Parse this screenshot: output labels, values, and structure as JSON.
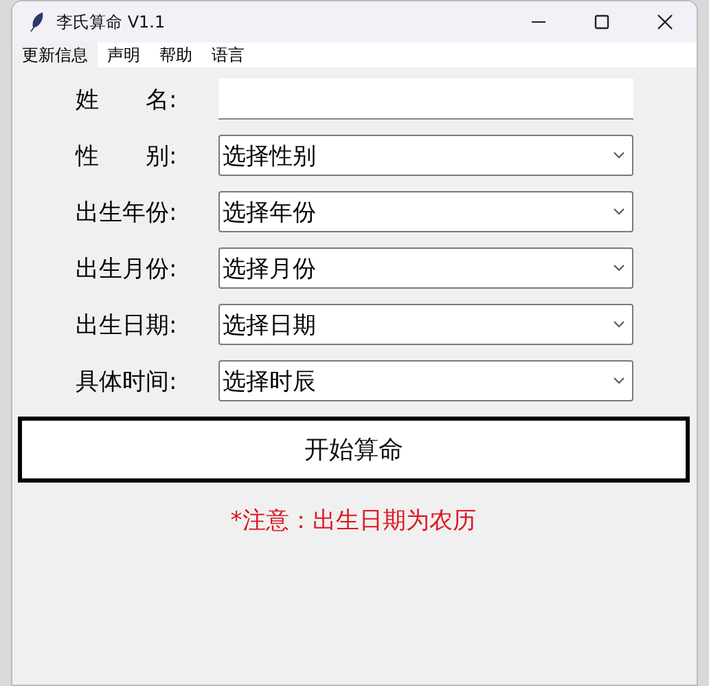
{
  "window": {
    "title": "李氏算命 V1.1"
  },
  "menu": [
    {
      "label": "更新信息",
      "selected": true
    },
    {
      "label": "声明",
      "selected": false
    },
    {
      "label": "帮助",
      "selected": false
    },
    {
      "label": "语言",
      "selected": false
    }
  ],
  "fields": [
    {
      "label": "姓　　名:",
      "kind": "entry"
    },
    {
      "label": "性　　别:",
      "kind": "combo",
      "value": "选择性别"
    },
    {
      "label": "出生年份:",
      "kind": "combo",
      "value": "选择年份"
    },
    {
      "label": "出生月份:",
      "kind": "combo",
      "value": "选择月份"
    },
    {
      "label": "出生日期:",
      "kind": "combo",
      "value": "选择日期"
    },
    {
      "label": "具体时间:",
      "kind": "combo",
      "value": "选择时辰"
    }
  ],
  "submit_button": "开始算命",
  "note": "*注意：出生日期为农历"
}
